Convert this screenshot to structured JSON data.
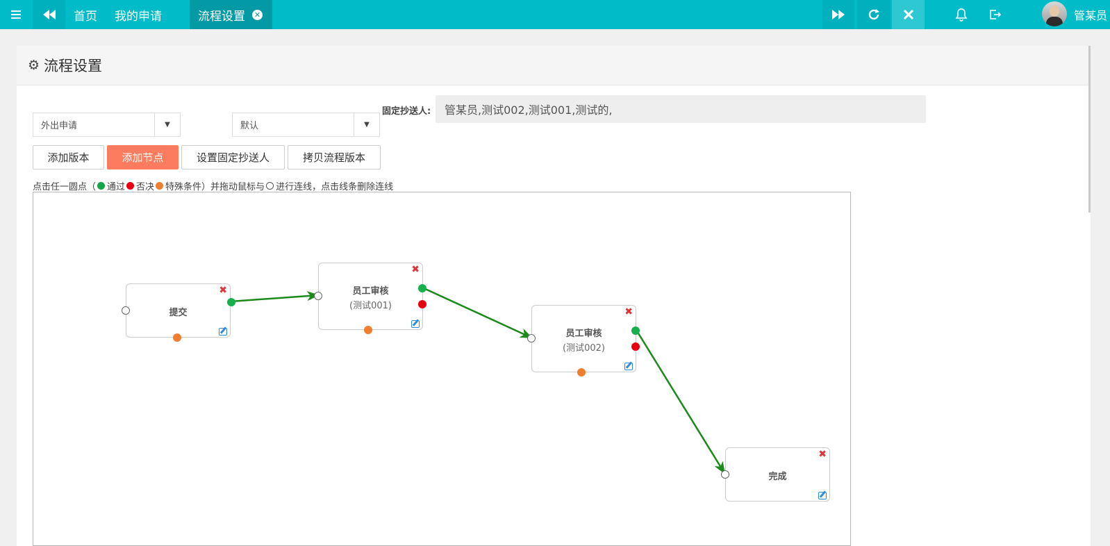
{
  "topbar": {
    "tabs": [
      "首页",
      "我的申请"
    ],
    "active_tab": "流程设置",
    "username": "管某员"
  },
  "panel": {
    "title": "流程设置"
  },
  "form": {
    "process_select": "外出申请",
    "version_select": "默认",
    "cc_label": "固定抄送人:",
    "cc_value": "管某员,测试002,测试001,测试的,"
  },
  "buttons": {
    "add_version": "添加版本",
    "add_node": "添加节点",
    "set_cc": "设置固定抄送人",
    "copy_version": "拷贝流程版本"
  },
  "hint": {
    "p1": "点击任一圆点（",
    "pass": "通过",
    "reject": "否决",
    "special": "特殊条件）并拖动鼠标与",
    "p2": "进行连线，点击线条删除连线"
  },
  "nodes": [
    {
      "title": "提交",
      "sub": ""
    },
    {
      "title": "员工审核",
      "sub": "(测试001)"
    },
    {
      "title": "员工审核",
      "sub": "(测试002)"
    },
    {
      "title": "完成",
      "sub": ""
    }
  ],
  "colors": {
    "topbar": "#00bcc9",
    "accent_button": "#fd7c5f",
    "pass": "#16b14c",
    "reject": "#e60012",
    "special": "#f07d30",
    "link": "#1a8a1a"
  },
  "icons": {
    "menu": "menu-icon",
    "back": "rewind-icon",
    "forward": "fast-forward-icon",
    "refresh": "refresh-icon",
    "close": "close-icon",
    "bell": "bell-icon",
    "logout": "logout-icon",
    "settings": "gear-icon"
  }
}
